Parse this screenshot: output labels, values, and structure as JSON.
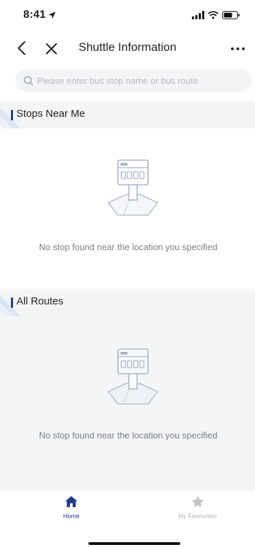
{
  "status_bar": {
    "time": "8:41"
  },
  "header": {
    "title": "Shuttle Information"
  },
  "search": {
    "placeholder": "Please enter bus stop name or bus route"
  },
  "sections": {
    "stops_near_me": {
      "title": "Stops Near Me",
      "empty_message": "No stop found near the location you specified"
    },
    "all_routes": {
      "title": "All Routes",
      "empty_message": "No stop found near the location you specified"
    }
  },
  "tab_bar": {
    "home_label": "Home",
    "favourites_label": "My Favourites",
    "active_color": "#1f3d86",
    "inactive_color": "#bfc3c9"
  },
  "colors": {
    "accent": "#1f3d86",
    "section_background": "#f4f5f7",
    "placeholder_text": "#b7bcc4",
    "illustration": "#aab3c5"
  }
}
